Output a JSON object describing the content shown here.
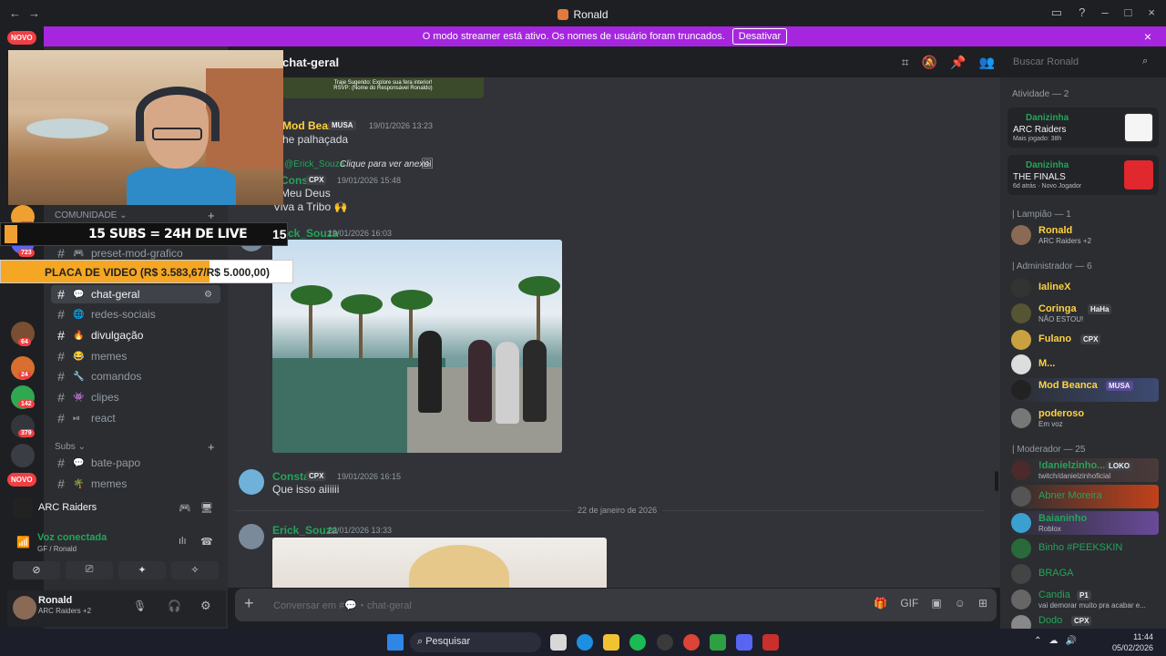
{
  "window": {
    "title": "Ronald"
  },
  "banner": {
    "text": "O modo streamer está ativo. Os nomes de usuário foram truncados.",
    "button": "Desativar",
    "close": "×"
  },
  "rail": {
    "novo_top": "NOVO",
    "novo_bottom": "NOVO",
    "badges": [
      "224",
      "723",
      "64",
      "24",
      "142",
      "379"
    ]
  },
  "overlay": {
    "subs_text": "15 SUBS = 24H DE LIVE",
    "subs_count": "15",
    "goal_text": "PLACA DE VIDEO (R$ 3.583,67/R$ 5.000,00)",
    "goal_progress": 0.7167
  },
  "sidebar": {
    "category_community": "COMUNIDADE",
    "category_subs": "Subs",
    "channels": [
      {
        "label": "preset-mod-grafico",
        "emoji": "🎮"
      },
      {
        "label": "chat-geral",
        "emoji": "💬"
      },
      {
        "label": "redes-sociais",
        "emoji": "🌐"
      },
      {
        "label": "divulgação",
        "emoji": "🔥"
      },
      {
        "label": "memes",
        "emoji": "😂"
      },
      {
        "label": "comandos",
        "emoji": "🔧"
      },
      {
        "label": "clipes",
        "emoji": "👾"
      },
      {
        "label": "react",
        "emoji": "⏯"
      }
    ],
    "subs_channels": [
      {
        "label": "bate-papo",
        "emoji": "💬"
      },
      {
        "label": "memes",
        "emoji": "🌴"
      }
    ],
    "activity_title": "ARC Raiders",
    "voice_status": "Voz conectada",
    "voice_channel": "GF / Ronald",
    "user_name": "Ronald",
    "user_status": "ARC Raiders +2"
  },
  "chat": {
    "channel_name": "chat-geral",
    "search_placeholder": "Buscar Ronald",
    "embed_line1": "Traje Sugerido: Explore sua fera interior!",
    "embed_line2": "RSVP: (Nome do Responsável Ronaldo)",
    "messages": [
      {
        "author": "Mod Beanca",
        "tag": "MUSA",
        "time": "19/01/2026 13:23",
        "text": "he palhaçada"
      },
      {
        "reply_user": "@Erick_Souza",
        "reply_text": "Clique para ver anexo"
      },
      {
        "author": "Consta",
        "tag": "CPX",
        "time": "19/01/2026 15:48",
        "text1": "Meu Deus",
        "text2": "Viva a Tribo 🙌"
      },
      {
        "author": "Erick_Souza",
        "time": "19/01/2026 16:03"
      },
      {
        "author": "Consta",
        "tag": "CPX",
        "time": "19/01/2026 16:15",
        "text": "Que isso aiiiiii"
      },
      {
        "author": "Erick_Souza",
        "time": "22/01/2026 13:33"
      }
    ],
    "date_divider": "22 de janeiro de 2026",
    "composer_placeholder": "Conversar em #💬・chat-geral"
  },
  "members": {
    "activity_header": "Atividade — 2",
    "activity_cards": [
      {
        "user": "Danizinha",
        "game": "ARC Raiders",
        "sub": "Mais jogado: 38h"
      },
      {
        "user": "Danizinha",
        "game": "THE FINALS",
        "sub": "6d atrás · Novo Jogador"
      }
    ],
    "groups": [
      {
        "header": "| Lampião — 1",
        "items": [
          {
            "name": "Ronald",
            "status": "ARC Raiders +2",
            "color": "#ffd23f"
          }
        ]
      },
      {
        "header": "| Administrador — 6",
        "items": [
          {
            "name": "IalineX",
            "status": "",
            "color": "#ffd23f"
          },
          {
            "name": "Coringa",
            "tag": "HaHa",
            "status": "NÃO ESTOU!",
            "color": "#ffd23f"
          },
          {
            "name": "Fulano",
            "tag": "CPX",
            "status": "",
            "color": "#ffd23f"
          },
          {
            "name": "M...",
            "status": "",
            "color": "#ffd23f"
          },
          {
            "name": "Mod Beanca",
            "tag": "MUSA",
            "status": "",
            "color": "#ffd23f"
          },
          {
            "name": "poderoso",
            "status": "Em voz",
            "color": "#ffd23f"
          }
        ]
      },
      {
        "header": "| Moderador — 25",
        "items": [
          {
            "name": "!danielzinho...",
            "tag": "LOKO",
            "status": "twitch/danielzinhoficial",
            "color": "#23a559"
          },
          {
            "name": "Abner Moreira",
            "status": "",
            "color": "#23a559"
          },
          {
            "name": "Baianinho",
            "status": "Roblox",
            "color": "#23a559"
          },
          {
            "name": "Binho #PEEKSKIN",
            "status": "",
            "color": "#23a559"
          },
          {
            "name": "BRAGA",
            "status": "",
            "color": "#23a559"
          },
          {
            "name": "Candia",
            "tag": "P1",
            "status": "vai demorar muito pra acabar e...",
            "color": "#23a559"
          },
          {
            "name": "Dodo",
            "tag": "CPX",
            "status": "",
            "color": "#23a559"
          }
        ]
      }
    ]
  },
  "taskbar": {
    "search": "Pesquisar",
    "time": "11:44",
    "date": "05/02/2026"
  },
  "colors": {
    "banner": "#a626e0",
    "accent_green": "#23a559",
    "mod_yellow": "#ffd23f",
    "badge_red": "#f23f43"
  }
}
